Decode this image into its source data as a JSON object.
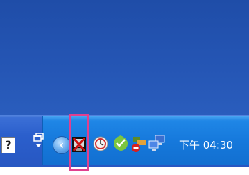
{
  "taskbar": {
    "help_icon": "question-icon",
    "help_glyph": "?",
    "restore_icon": "restore-window-icon",
    "collapse_glyph": "‹",
    "tray_icons": [
      "no-network-icon",
      "clock-refresh-icon",
      "green-check-icon",
      "network-warning-icon",
      "network-computers-icon"
    ],
    "clock_text": "下午 04:30"
  },
  "highlight": {
    "color": "#e0408f"
  },
  "colors": {
    "desktop": "#2556b5",
    "taskbar": "#2b5fcc",
    "tray": "#1679dc"
  }
}
